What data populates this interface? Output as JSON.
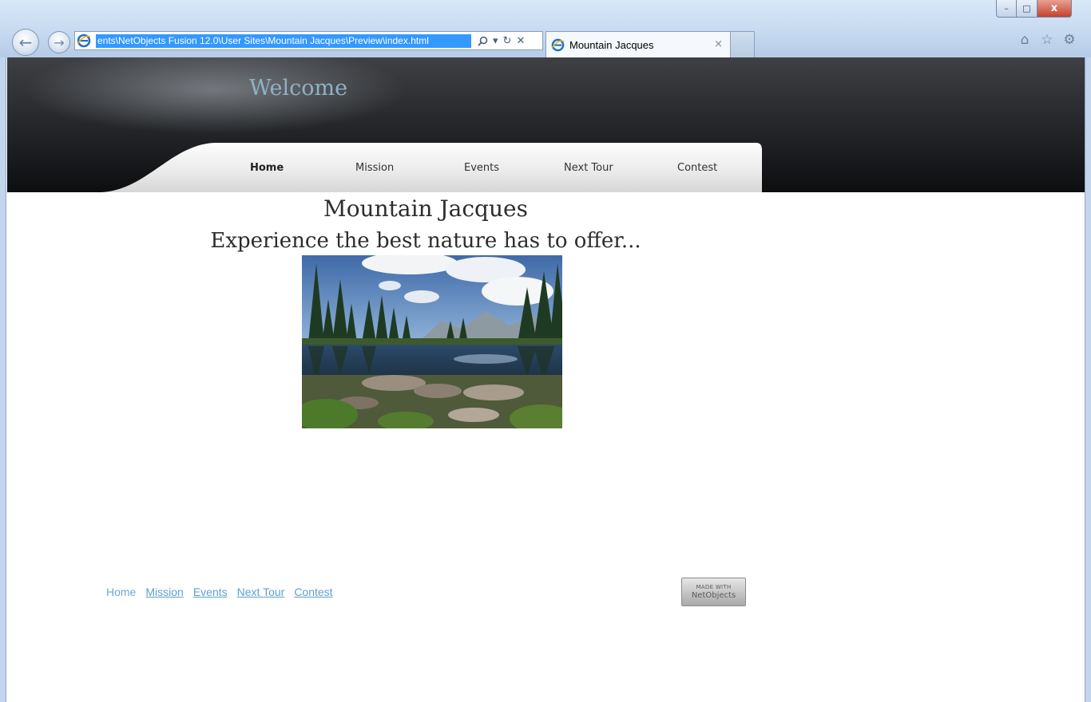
{
  "browser": {
    "address_url": "ents\\NetObjects Fusion 12.0\\User Sites\\Mountain Jacques\\Preview\\index.html",
    "search_icon": "magnifier-icon",
    "dropdown_glyph": "▾",
    "refresh_glyph": "↻",
    "stop_glyph": "✕",
    "tab_title": "Mountain Jacques",
    "tab_close": "×",
    "back_glyph": "←",
    "forward_glyph": "→",
    "home_glyph": "⌂",
    "favorites_glyph": "☆",
    "tools_glyph": "⚙",
    "min_glyph": "–",
    "max_glyph": "□",
    "close_glyph": "x"
  },
  "header": {
    "welcome": "Welcome",
    "nav": [
      {
        "label": "Home"
      },
      {
        "label": "Mission"
      },
      {
        "label": "Events"
      },
      {
        "label": "Next Tour"
      },
      {
        "label": "Contest"
      }
    ]
  },
  "main": {
    "title": "Mountain Jacques",
    "tagline": "Experience the best nature has to offer..."
  },
  "footer": {
    "links": [
      {
        "label": "Home"
      },
      {
        "label": "Mission"
      },
      {
        "label": "Events"
      },
      {
        "label": "Next Tour"
      },
      {
        "label": "Contest"
      }
    ],
    "badge_top": "MADE WITH",
    "badge_bottom": "NetObjects"
  },
  "colors": {
    "welcome": "#8eb2c6",
    "footer_link": "#5c9fd0",
    "address_highlight": "#3399ff"
  }
}
